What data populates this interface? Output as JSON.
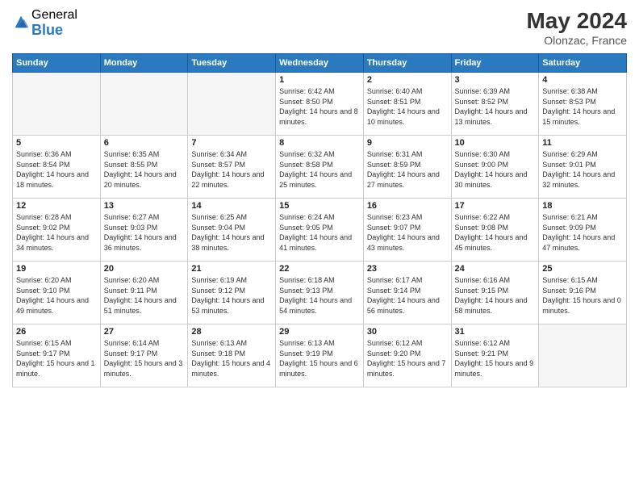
{
  "logo": {
    "general": "General",
    "blue": "Blue"
  },
  "header": {
    "month_year": "May 2024",
    "location": "Olonzac, France"
  },
  "days_of_week": [
    "Sunday",
    "Monday",
    "Tuesday",
    "Wednesday",
    "Thursday",
    "Friday",
    "Saturday"
  ],
  "weeks": [
    [
      {
        "day": "",
        "empty": true
      },
      {
        "day": "",
        "empty": true
      },
      {
        "day": "",
        "empty": true
      },
      {
        "day": "1",
        "sunrise": "6:42 AM",
        "sunset": "8:50 PM",
        "daylight": "14 hours and 8 minutes."
      },
      {
        "day": "2",
        "sunrise": "6:40 AM",
        "sunset": "8:51 PM",
        "daylight": "14 hours and 10 minutes."
      },
      {
        "day": "3",
        "sunrise": "6:39 AM",
        "sunset": "8:52 PM",
        "daylight": "14 hours and 13 minutes."
      },
      {
        "day": "4",
        "sunrise": "6:38 AM",
        "sunset": "8:53 PM",
        "daylight": "14 hours and 15 minutes."
      }
    ],
    [
      {
        "day": "5",
        "sunrise": "6:36 AM",
        "sunset": "8:54 PM",
        "daylight": "14 hours and 18 minutes."
      },
      {
        "day": "6",
        "sunrise": "6:35 AM",
        "sunset": "8:55 PM",
        "daylight": "14 hours and 20 minutes."
      },
      {
        "day": "7",
        "sunrise": "6:34 AM",
        "sunset": "8:57 PM",
        "daylight": "14 hours and 22 minutes."
      },
      {
        "day": "8",
        "sunrise": "6:32 AM",
        "sunset": "8:58 PM",
        "daylight": "14 hours and 25 minutes."
      },
      {
        "day": "9",
        "sunrise": "6:31 AM",
        "sunset": "8:59 PM",
        "daylight": "14 hours and 27 minutes."
      },
      {
        "day": "10",
        "sunrise": "6:30 AM",
        "sunset": "9:00 PM",
        "daylight": "14 hours and 30 minutes."
      },
      {
        "day": "11",
        "sunrise": "6:29 AM",
        "sunset": "9:01 PM",
        "daylight": "14 hours and 32 minutes."
      }
    ],
    [
      {
        "day": "12",
        "sunrise": "6:28 AM",
        "sunset": "9:02 PM",
        "daylight": "14 hours and 34 minutes."
      },
      {
        "day": "13",
        "sunrise": "6:27 AM",
        "sunset": "9:03 PM",
        "daylight": "14 hours and 36 minutes."
      },
      {
        "day": "14",
        "sunrise": "6:25 AM",
        "sunset": "9:04 PM",
        "daylight": "14 hours and 38 minutes."
      },
      {
        "day": "15",
        "sunrise": "6:24 AM",
        "sunset": "9:05 PM",
        "daylight": "14 hours and 41 minutes."
      },
      {
        "day": "16",
        "sunrise": "6:23 AM",
        "sunset": "9:07 PM",
        "daylight": "14 hours and 43 minutes."
      },
      {
        "day": "17",
        "sunrise": "6:22 AM",
        "sunset": "9:08 PM",
        "daylight": "14 hours and 45 minutes."
      },
      {
        "day": "18",
        "sunrise": "6:21 AM",
        "sunset": "9:09 PM",
        "daylight": "14 hours and 47 minutes."
      }
    ],
    [
      {
        "day": "19",
        "sunrise": "6:20 AM",
        "sunset": "9:10 PM",
        "daylight": "14 hours and 49 minutes."
      },
      {
        "day": "20",
        "sunrise": "6:20 AM",
        "sunset": "9:11 PM",
        "daylight": "14 hours and 51 minutes."
      },
      {
        "day": "21",
        "sunrise": "6:19 AM",
        "sunset": "9:12 PM",
        "daylight": "14 hours and 53 minutes."
      },
      {
        "day": "22",
        "sunrise": "6:18 AM",
        "sunset": "9:13 PM",
        "daylight": "14 hours and 54 minutes."
      },
      {
        "day": "23",
        "sunrise": "6:17 AM",
        "sunset": "9:14 PM",
        "daylight": "14 hours and 56 minutes."
      },
      {
        "day": "24",
        "sunrise": "6:16 AM",
        "sunset": "9:15 PM",
        "daylight": "14 hours and 58 minutes."
      },
      {
        "day": "25",
        "sunrise": "6:15 AM",
        "sunset": "9:16 PM",
        "daylight": "15 hours and 0 minutes."
      }
    ],
    [
      {
        "day": "26",
        "sunrise": "6:15 AM",
        "sunset": "9:17 PM",
        "daylight": "15 hours and 1 minute."
      },
      {
        "day": "27",
        "sunrise": "6:14 AM",
        "sunset": "9:17 PM",
        "daylight": "15 hours and 3 minutes."
      },
      {
        "day": "28",
        "sunrise": "6:13 AM",
        "sunset": "9:18 PM",
        "daylight": "15 hours and 4 minutes."
      },
      {
        "day": "29",
        "sunrise": "6:13 AM",
        "sunset": "9:19 PM",
        "daylight": "15 hours and 6 minutes."
      },
      {
        "day": "30",
        "sunrise": "6:12 AM",
        "sunset": "9:20 PM",
        "daylight": "15 hours and 7 minutes."
      },
      {
        "day": "31",
        "sunrise": "6:12 AM",
        "sunset": "9:21 PM",
        "daylight": "15 hours and 9 minutes."
      },
      {
        "day": "",
        "empty": true
      }
    ]
  ]
}
